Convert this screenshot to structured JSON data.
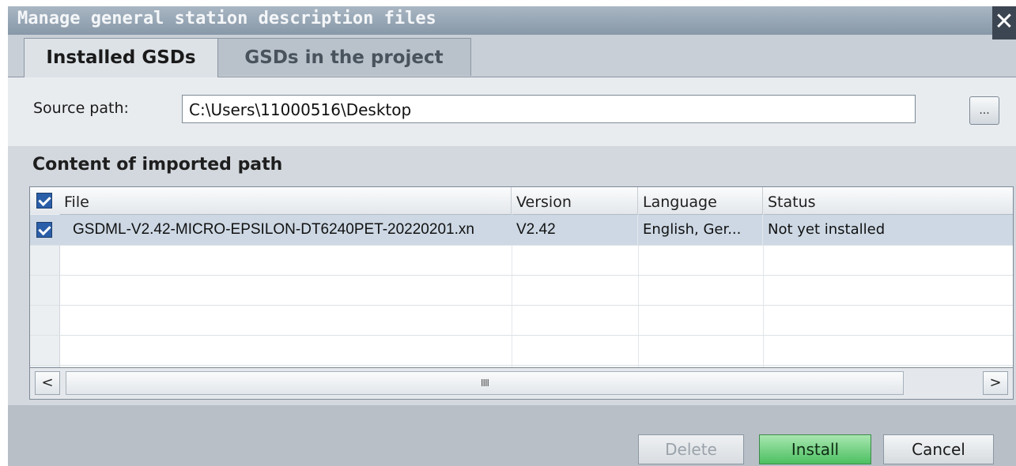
{
  "dialog": {
    "title": "Manage general station description files",
    "close_glyph": "✕"
  },
  "tabs": [
    {
      "label": "Installed GSDs",
      "active": true
    },
    {
      "label": "GSDs in the project",
      "active": false
    }
  ],
  "source": {
    "label": "Source path:",
    "value": "C:\\Users\\11000516\\Desktop",
    "browse_label": "..."
  },
  "section_title": "Content of imported path",
  "table": {
    "columns": [
      "File",
      "Version",
      "Language",
      "Status"
    ],
    "header_checked": true,
    "rows": [
      {
        "checked": true,
        "file": "GSDML-V2.42-MICRO-EPSILON-DT6240PET-20220201.xn",
        "version": "V2.42",
        "language": "English, Ger...",
        "status": "Not yet installed"
      }
    ]
  },
  "scrollbar": {
    "left_arrow": "<",
    "right_arrow": ">",
    "thumb_grip": "IIII"
  },
  "buttons": {
    "delete": "Delete",
    "install": "Install",
    "cancel": "Cancel"
  },
  "colors": {
    "install_accent": "#4cc061",
    "checkbox": "#2a5ea8",
    "selected_row": "#cdd8e4"
  }
}
